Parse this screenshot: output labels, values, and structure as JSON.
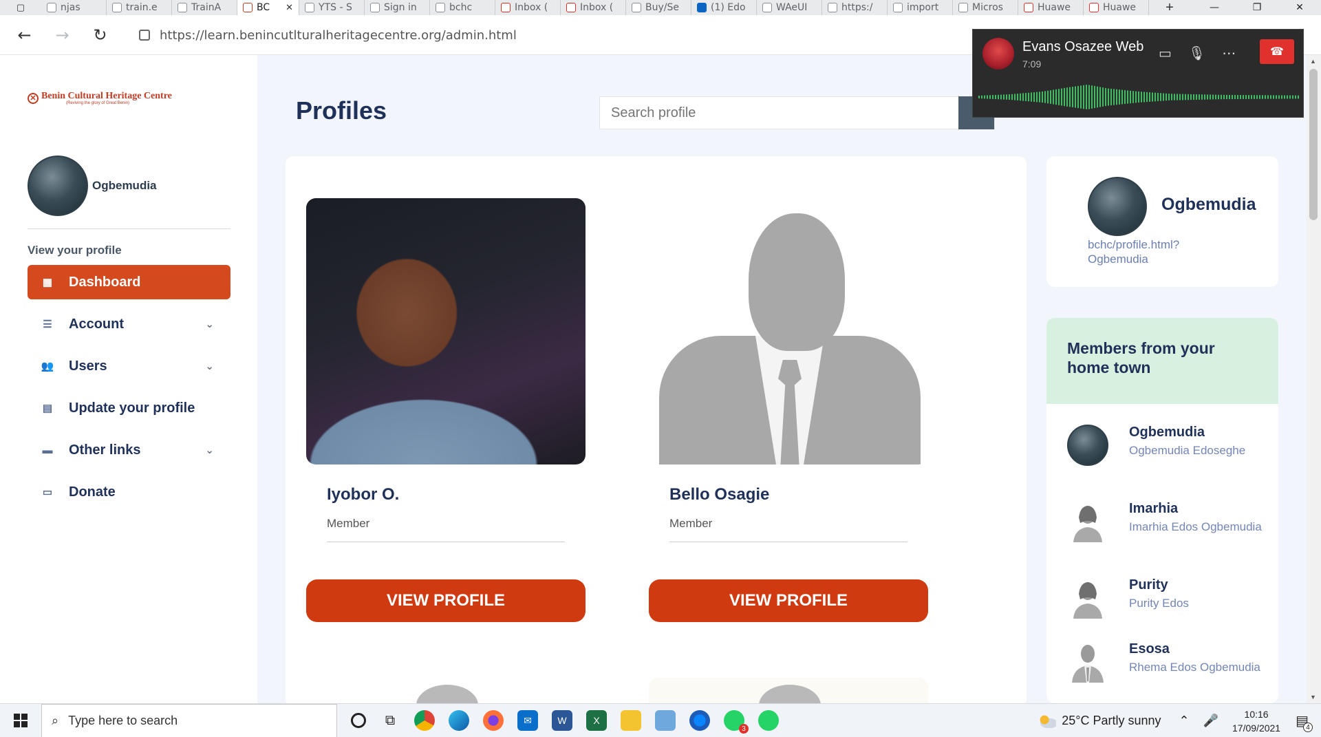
{
  "browser": {
    "tabs": [
      {
        "label": "njas"
      },
      {
        "label": "train.e"
      },
      {
        "label": "TrainA"
      },
      {
        "label": "BC",
        "active": true
      },
      {
        "label": "YTS - S"
      },
      {
        "label": "Sign in"
      },
      {
        "label": "bchc"
      },
      {
        "label": "Inbox ("
      },
      {
        "label": "Inbox ("
      },
      {
        "label": "Buy/Se"
      },
      {
        "label": "(1) Edo"
      },
      {
        "label": "WAeUI"
      },
      {
        "label": "https:/"
      },
      {
        "label": "import"
      },
      {
        "label": "Micros"
      },
      {
        "label": "Huawe"
      },
      {
        "label": "Huawe"
      }
    ],
    "url": "https://learn.benincutlturalheritagecentre.org/admin.html"
  },
  "sidebar": {
    "logo_title": "Benin Cultural Heritage Centre",
    "logo_tagline": "(Reviving the glory of Great Benin)",
    "user_name": "Ogbemudia",
    "caption": "View your profile",
    "menu": [
      {
        "label": "Dashboard",
        "icon": "grid-icon",
        "active": true
      },
      {
        "label": "Account",
        "icon": "layers-icon",
        "has_submenu": true
      },
      {
        "label": "Users",
        "icon": "users-icon",
        "has_submenu": true
      },
      {
        "label": "Update your profile",
        "icon": "document-icon"
      },
      {
        "label": "Other links",
        "icon": "briefcase-icon",
        "has_submenu": true
      },
      {
        "label": "Donate",
        "icon": "money-icon"
      }
    ]
  },
  "main": {
    "title": "Profiles",
    "search_placeholder": "Search profile",
    "profiles": [
      {
        "name": "Iyobor O.",
        "role": "Member",
        "button": "VIEW PROFILE"
      },
      {
        "name": "Bello Osagie",
        "role": "Member",
        "button": "VIEW PROFILE"
      }
    ]
  },
  "right": {
    "me": {
      "name": "Ogbemudia",
      "link": "bchc/profile.html?Ogbemudia"
    },
    "hometown_title": "Members from your home town",
    "members": [
      {
        "name": "Ogbemudia",
        "desc": "Ogbemudia Edoseghe"
      },
      {
        "name": "Imarhia",
        "desc": "Imarhia Edos Ogbemudia"
      },
      {
        "name": "Purity",
        "desc": "Purity Edos"
      },
      {
        "name": "Esosa",
        "desc": "Rhema Edos Ogbemudia"
      }
    ]
  },
  "call": {
    "caller": "Evans Osazee Web",
    "time": "7:09"
  },
  "taskbar": {
    "search_placeholder": "Type here to search",
    "weather": "25°C  Partly sunny",
    "time": "10:16",
    "date": "17/09/2021",
    "whatsapp_badge": "3",
    "notification_count": "4"
  },
  "colors": {
    "accent": "#d44a1e",
    "button": "#cf3a10",
    "navy": "#1f3158",
    "hometown_header": "#d8f0e0"
  }
}
